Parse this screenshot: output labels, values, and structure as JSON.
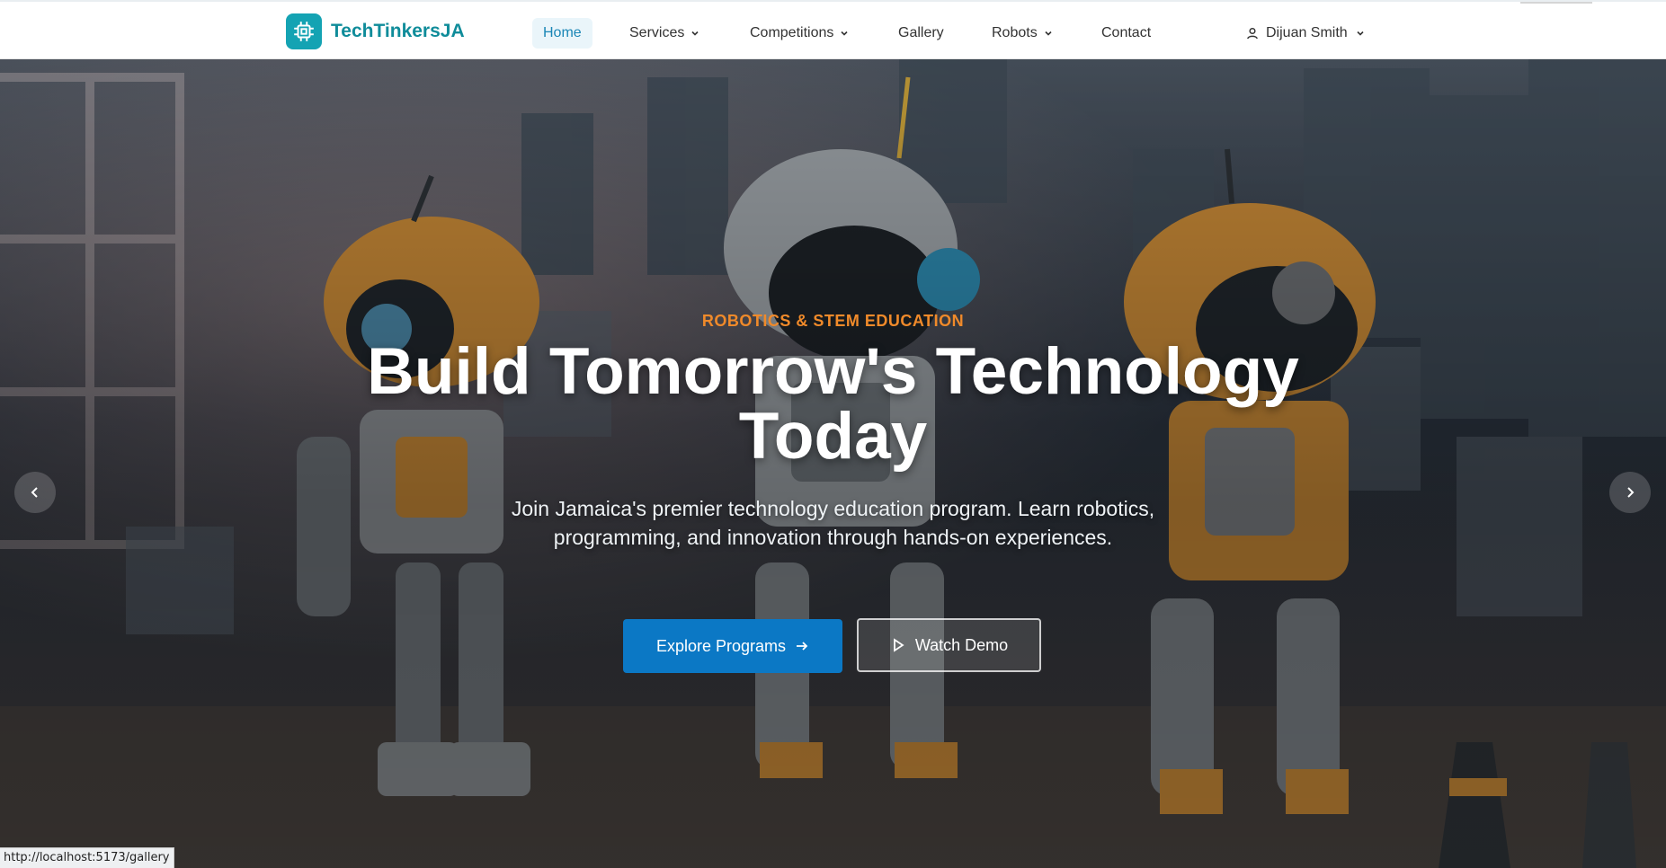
{
  "nav": {
    "brand": "TechTinkersJA",
    "home": "Home",
    "services": "Services",
    "competitions": "Competitions",
    "gallery": "Gallery",
    "robots": "Robots",
    "contact": "Contact",
    "user_name": "Dijuan Smith"
  },
  "hero": {
    "eyebrow": "ROBOTICS & STEM EDUCATION",
    "headline": "Build Tomorrow's Technology Today",
    "subtitle": "Join Jamaica's premier technology education program. Learn robotics, programming, and innovation through hands-on experiences.",
    "primary_cta": "Explore Programs",
    "secondary_cta": "Watch Demo"
  },
  "status_bar": {
    "url": "http://localhost:5173/gallery"
  },
  "colors": {
    "brand": "#14a3b3",
    "primary": "#0b78c5",
    "accent": "#f08a2a"
  }
}
